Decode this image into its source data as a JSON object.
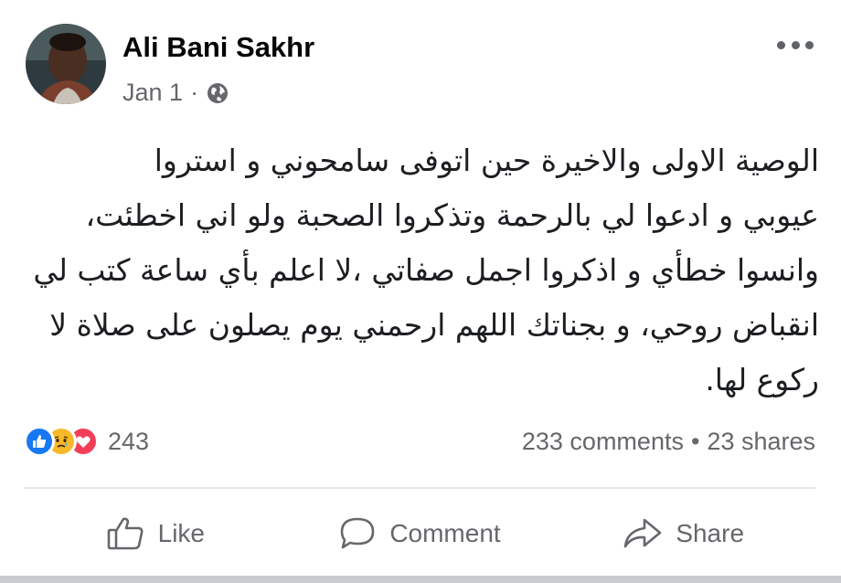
{
  "post": {
    "author": "Ali Bani Sakhr",
    "date": "Jan 1",
    "separator": "·",
    "privacy_icon": "globe-icon",
    "more_icon": "more-horizontal-icon",
    "text": "الوصية الاولى والاخيرة حين اتوفى سامحوني  و استروا\nعيوبي و ادعوا لي بالرحمة وتذكروا الصحبة ولو اني اخطئت،\nوانسوا خطأي و اذكروا اجمل صفاتي ،لا اعلم بأي ساعة كتب لي\nانقباض روحي، و بجناتك اللهم ارحمني يوم يصلون على صلاة لا\nركوع لها."
  },
  "stats": {
    "reaction_icons": [
      "like-icon",
      "sad-icon",
      "love-icon"
    ],
    "reaction_count": "243",
    "comments": "233 comments",
    "bullet": "•",
    "shares": "23 shares"
  },
  "actions": {
    "like_label": "Like",
    "comment_label": "Comment",
    "share_label": "Share"
  },
  "colors": {
    "like_blue": "#1877f2",
    "love_red": "#f33e58",
    "sad_yellow": "#f7b928",
    "secondary_text": "#65676b"
  }
}
